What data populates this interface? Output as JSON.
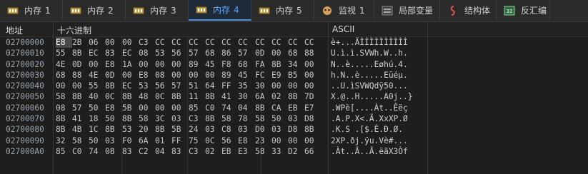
{
  "tabs": [
    {
      "label": "内存",
      "num": "1",
      "icon": "memory-icon",
      "active": false
    },
    {
      "label": "内存",
      "num": "2",
      "icon": "memory-icon",
      "active": false
    },
    {
      "label": "内存",
      "num": "3",
      "icon": "memory-icon",
      "active": false
    },
    {
      "label": "内存",
      "num": "4",
      "icon": "memory-icon",
      "active": true
    },
    {
      "label": "内存",
      "num": "5",
      "icon": "memory-icon",
      "active": false
    },
    {
      "label": "监视",
      "num": "1",
      "icon": "watch-icon",
      "active": false
    },
    {
      "label": "局部变量",
      "num": "",
      "icon": "locals-icon",
      "active": false
    },
    {
      "label": "结构体",
      "num": "",
      "icon": "struct-icon",
      "active": false
    },
    {
      "label": "反汇编",
      "num": "",
      "icon": "disasm-icon",
      "active": false
    }
  ],
  "header": {
    "address": "地址",
    "hex": "十六进制",
    "ascii": "ASCII"
  },
  "rows": [
    {
      "addr": "02700000",
      "hex": [
        "E8",
        "2B",
        "06",
        "00",
        "00",
        "C3",
        "CC",
        "CC",
        "CC",
        "CC",
        "CC",
        "CC",
        "CC",
        "CC",
        "CC",
        "CC"
      ],
      "ascii": "è+...ÃÌÌÌÌÌÌÌÌÌÌ"
    },
    {
      "addr": "02700010",
      "hex": [
        "55",
        "8B",
        "EC",
        "83",
        "EC",
        "08",
        "53",
        "56",
        "57",
        "68",
        "86",
        "57",
        "0D",
        "00",
        "68",
        "88"
      ],
      "ascii": "U.ì.ì.SVWh.W..h."
    },
    {
      "addr": "02700020",
      "hex": [
        "4E",
        "0D",
        "00",
        "E8",
        "1A",
        "00",
        "00",
        "00",
        "89",
        "45",
        "F8",
        "68",
        "FA",
        "8B",
        "34",
        "00"
      ],
      "ascii": "N..è.....Eøhú.4."
    },
    {
      "addr": "02700030",
      "hex": [
        "68",
        "88",
        "4E",
        "0D",
        "00",
        "E8",
        "08",
        "00",
        "00",
        "00",
        "89",
        "45",
        "FC",
        "E9",
        "B5",
        "00"
      ],
      "ascii": "h.N..è.....Eüéµ."
    },
    {
      "addr": "02700040",
      "hex": [
        "00",
        "00",
        "55",
        "8B",
        "EC",
        "53",
        "56",
        "57",
        "51",
        "64",
        "FF",
        "35",
        "30",
        "00",
        "00",
        "00"
      ],
      "ascii": "..U.ìSVWQdÿ50..."
    },
    {
      "addr": "02700050",
      "hex": [
        "58",
        "8B",
        "40",
        "0C",
        "8B",
        "48",
        "0C",
        "8B",
        "11",
        "8B",
        "41",
        "30",
        "6A",
        "02",
        "8B",
        "7D"
      ],
      "ascii": "X.@..H.....A0j..}"
    },
    {
      "addr": "02700060",
      "hex": [
        "08",
        "57",
        "50",
        "E8",
        "5B",
        "00",
        "00",
        "00",
        "85",
        "C0",
        "74",
        "04",
        "8B",
        "CA",
        "EB",
        "E7"
      ],
      "ascii": ".WPè[....Àt..Êëç"
    },
    {
      "addr": "02700070",
      "hex": [
        "8B",
        "41",
        "18",
        "50",
        "8B",
        "58",
        "3C",
        "03",
        "C3",
        "8B",
        "58",
        "78",
        "58",
        "50",
        "03",
        "D8"
      ],
      "ascii": ".A.P.X<.Ã.XxXP.Ø"
    },
    {
      "addr": "02700080",
      "hex": [
        "8B",
        "4B",
        "1C",
        "8B",
        "53",
        "20",
        "8B",
        "5B",
        "24",
        "03",
        "C8",
        "03",
        "D0",
        "03",
        "D8",
        "8B"
      ],
      "ascii": ".K.S .[$.È.Ð.Ø."
    },
    {
      "addr": "02700090",
      "hex": [
        "32",
        "58",
        "50",
        "03",
        "F0",
        "6A",
        "01",
        "FF",
        "75",
        "0C",
        "56",
        "E8",
        "23",
        "00",
        "00",
        "00"
      ],
      "ascii": "2XP.ðj.ÿu.Vè#..."
    },
    {
      "addr": "027000A0",
      "hex": [
        "85",
        "C0",
        "74",
        "08",
        "83",
        "C2",
        "04",
        "83",
        "C3",
        "02",
        "EB",
        "E3",
        "58",
        "33",
        "D2",
        "66"
      ],
      "ascii": ".Àt..Â..Ã.ëãX3Òf"
    }
  ]
}
